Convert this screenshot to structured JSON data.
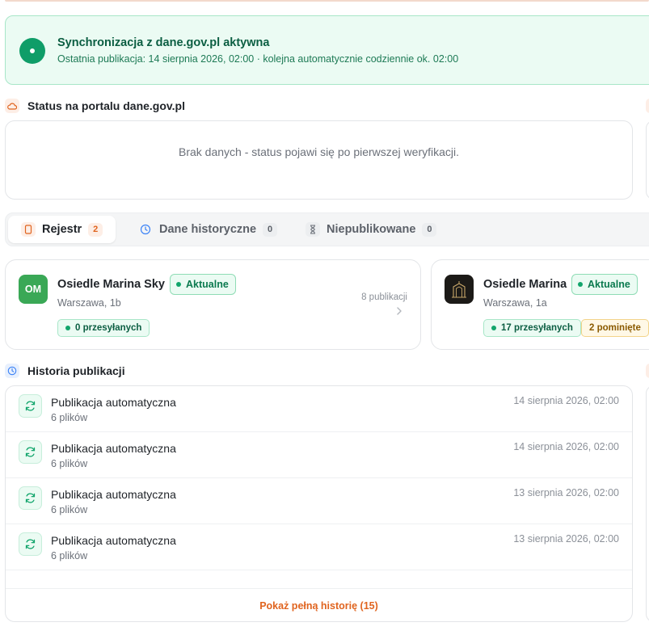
{
  "sync_banner": {
    "title": "Synchronizacja z dane.gov.pl aktywna",
    "subtitle": "Ostatnia publikacja: 14 sierpnia 2026, 02:00 · kolejna automatycznie codziennie ok. 02:00"
  },
  "portal_status": {
    "heading": "Status na portalu dane.gov.pl",
    "empty_message": "Brak danych - status pojawi się po pierwszej weryfikacji."
  },
  "tabs": [
    {
      "label": "Rejestr",
      "count": "2",
      "active": true
    },
    {
      "label": "Dane historyczne",
      "count": "0",
      "active": false
    },
    {
      "label": "Niepublikowane",
      "count": "0",
      "active": false
    }
  ],
  "register": [
    {
      "avatar": "OM",
      "avatar_color": "#3aa856",
      "name": "Osiedle Marina Sky",
      "status": "Aktualne",
      "address": "Warszawa, 1b",
      "publications": "8 publikacji",
      "pills": [
        {
          "text": "0 przesyłanych",
          "type": "green"
        }
      ]
    },
    {
      "avatar": "",
      "avatar_color": "#1c1a17",
      "name": "Osiedle Marina",
      "status": "Aktualne",
      "address": "Warszawa, 1a",
      "publications": "",
      "pills": [
        {
          "text": "17 przesyłanych",
          "type": "green"
        },
        {
          "text": "2 pominięte",
          "type": "amber"
        }
      ]
    }
  ],
  "history": {
    "heading": "Historia publikacji",
    "rows": [
      {
        "title": "Publikacja automatyczna",
        "files": "6 plików",
        "time": "14 sierpnia 2026, 02:00"
      },
      {
        "title": "Publikacja automatyczna",
        "files": "6 plików",
        "time": "14 sierpnia 2026, 02:00"
      },
      {
        "title": "Publikacja automatyczna",
        "files": "6 plików",
        "time": "13 sierpnia 2026, 02:00"
      },
      {
        "title": "Publikacja automatyczna",
        "files": "6 plików",
        "time": "13 sierpnia 2026, 02:00"
      }
    ],
    "show_all_label": "Pokaż pełną historię (15)"
  },
  "colors": {
    "accent": "#e0641f",
    "success": "#0f9d68"
  },
  "icons": {
    "banner": "status-dot-icon",
    "portal": "cloud-icon",
    "tab_register": "document-icon",
    "tab_history": "clock-icon",
    "tab_unpublished": "hourglass-icon",
    "history": "clock-icon",
    "history_row": "refresh-icon",
    "card_arrow": "chevron-right-icon"
  }
}
